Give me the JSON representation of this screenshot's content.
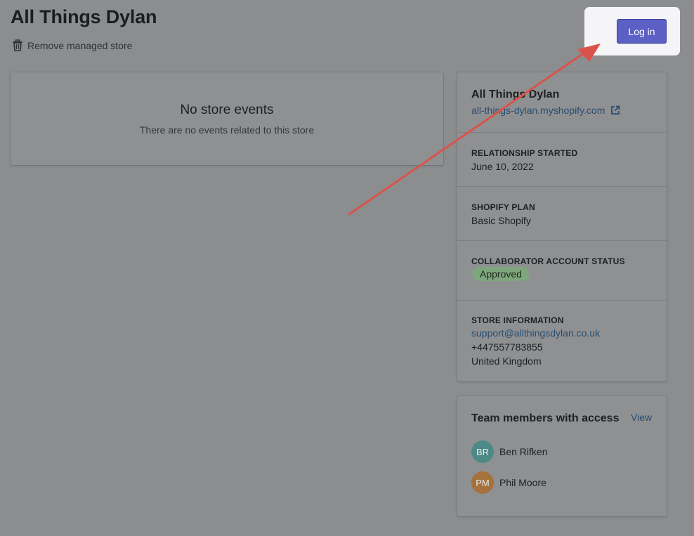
{
  "page": {
    "title": "All Things Dylan",
    "remove_label": "Remove managed store",
    "login_label": "Log in"
  },
  "events": {
    "title": "No store events",
    "subtitle": "There are no events related to this store"
  },
  "store": {
    "name": "All Things Dylan",
    "url": "all-things-dylan.myshopify.com",
    "relationship_heading": "RELATIONSHIP STARTED",
    "relationship_value": "June 10, 2022",
    "plan_heading": "SHOPIFY PLAN",
    "plan_value": "Basic Shopify",
    "collab_heading": "COLLABORATOR ACCOUNT STATUS",
    "collab_value": "Approved",
    "info_heading": "STORE INFORMATION",
    "email": "support@allthingsdylan.co.uk",
    "phone": "+447557783855",
    "country": "United Kingdom"
  },
  "team": {
    "title": "Team members with access",
    "view_label": "View",
    "members": [
      {
        "initials": "BR",
        "name": "Ben Rifken",
        "color": "#4d8a87"
      },
      {
        "initials": "PM",
        "name": "Phil Moore",
        "color": "#a5713c"
      }
    ]
  },
  "colors": {
    "accent": "#5c5fc4",
    "link": "#274d72",
    "badge_success": "#7ea67c",
    "annotation_arrow": "#d9534a"
  },
  "icons": {
    "remove": "trash-icon",
    "external": "external-link-icon",
    "annotation": "red-arrow-annotation"
  }
}
